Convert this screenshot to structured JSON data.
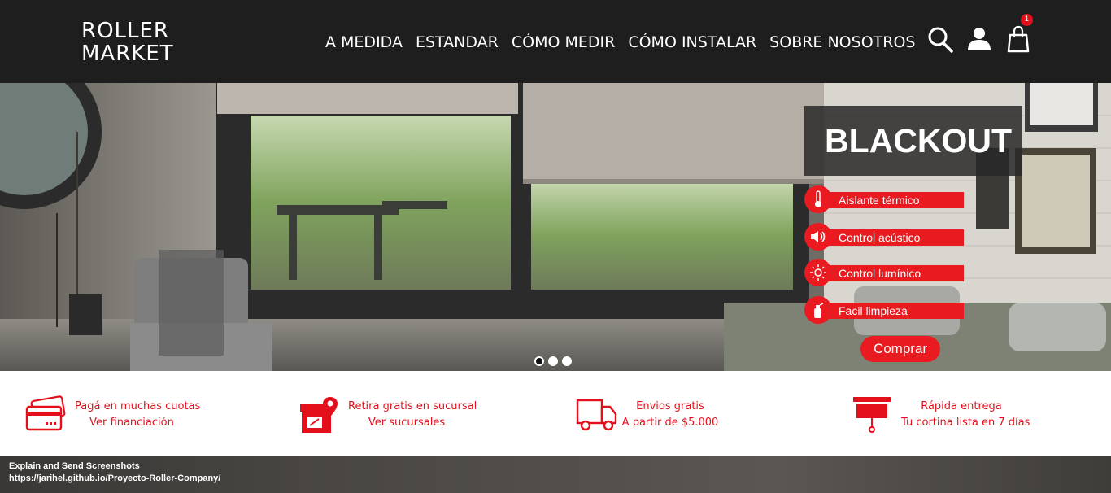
{
  "header": {
    "logo_line1": "ROLLER",
    "logo_line2": "MARKET",
    "nav": [
      "A MEDIDA",
      "ESTANDAR",
      "CÓMO MEDIR",
      "CÓMO INSTALAR",
      "SOBRE NOSOTROS"
    ],
    "cart_count": "1"
  },
  "hero": {
    "title": "BLACKOUT",
    "features": [
      {
        "label": "Aislante térmico",
        "icon": "thermometer-icon"
      },
      {
        "label": "Control acústico",
        "icon": "speaker-icon"
      },
      {
        "label": "Control lumínico",
        "icon": "sun-icon"
      },
      {
        "label": "Facil limpieza",
        "icon": "spray-icon"
      }
    ],
    "button": "Comprar",
    "slides": 3,
    "active_slide": 0
  },
  "benefits": [
    {
      "line1": "Pagá en muchas cuotas",
      "line2": "Ver financiación",
      "icon": "credit-card-icon"
    },
    {
      "line1": "Retira gratis en sucursal",
      "line2": "Ver sucursales",
      "icon": "store-pin-icon"
    },
    {
      "line1": "Envios gratis",
      "line2": "A partir de $5.000",
      "icon": "truck-icon"
    },
    {
      "line1": "Rápida entrega",
      "line2": "Tu cortina lista en 7 días",
      "icon": "roller-blind-icon"
    }
  ],
  "overlay": {
    "title": "Explain and Send Screenshots",
    "url": "https://jarihel.github.io/Proyecto-Roller-Company/"
  },
  "colors": {
    "header_bg": "#1e1e1e",
    "accent": "#ea1b20",
    "text_red": "#e3101b"
  }
}
